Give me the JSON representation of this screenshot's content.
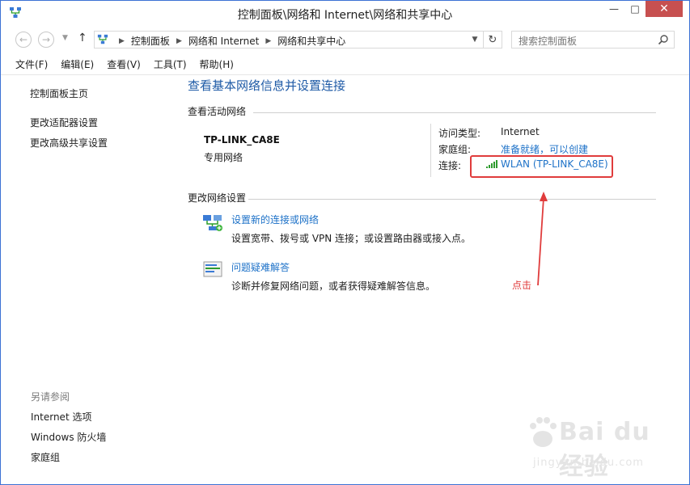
{
  "window": {
    "title": "控制面板\\网络和 Internet\\网络和共享中心",
    "controls": {
      "minimize": "—",
      "maximize": "□",
      "close": "✕"
    }
  },
  "address": {
    "crumbs": [
      "控制面板",
      "网络和 Internet",
      "网络和共享中心"
    ],
    "search_placeholder": "搜索控制面板"
  },
  "menu": [
    "文件(F)",
    "编辑(E)",
    "查看(V)",
    "工具(T)",
    "帮助(H)"
  ],
  "sidebar": {
    "links": [
      "控制面板主页",
      "更改适配器设置",
      "更改高级共享设置"
    ],
    "see_also_title": "另请参阅",
    "see_also": [
      "Internet 选项",
      "Windows 防火墙",
      "家庭组"
    ]
  },
  "main": {
    "title": "查看基本网络信息并设置连接",
    "active_section": "查看活动网络",
    "network": {
      "name": "TP-LINK_CA8E",
      "type": "专用网络",
      "access_type_label": "访问类型:",
      "access_type_value": "Internet",
      "homegroup_label": "家庭组:",
      "homegroup_value": "准备就绪，可以创建",
      "connection_label": "连接:",
      "connection_value": "WLAN (TP-LINK_CA8E)"
    },
    "change_section": "更改网络设置",
    "tasks": [
      {
        "link": "设置新的连接或网络",
        "desc": "设置宽带、拨号或 VPN 连接；或设置路由器或接入点。"
      },
      {
        "link": "问题疑难解答",
        "desc": "诊断并修复网络问题，或者获得疑难解答信息。"
      }
    ],
    "annotation": "点击"
  },
  "colors": {
    "link": "#1e72c8",
    "title_blue": "#1e5aa6",
    "annotation_red": "#e03c3c",
    "close_button": "#c75050"
  },
  "icons": {
    "app": "network-sharing-icon",
    "back": "back-arrow-icon",
    "forward": "forward-arrow-icon",
    "up": "up-arrow-icon",
    "refresh": "refresh-icon",
    "search": "search-icon",
    "signal": "wifi-signal-icon",
    "new_connection": "new-connection-icon",
    "troubleshoot": "troubleshoot-icon"
  }
}
